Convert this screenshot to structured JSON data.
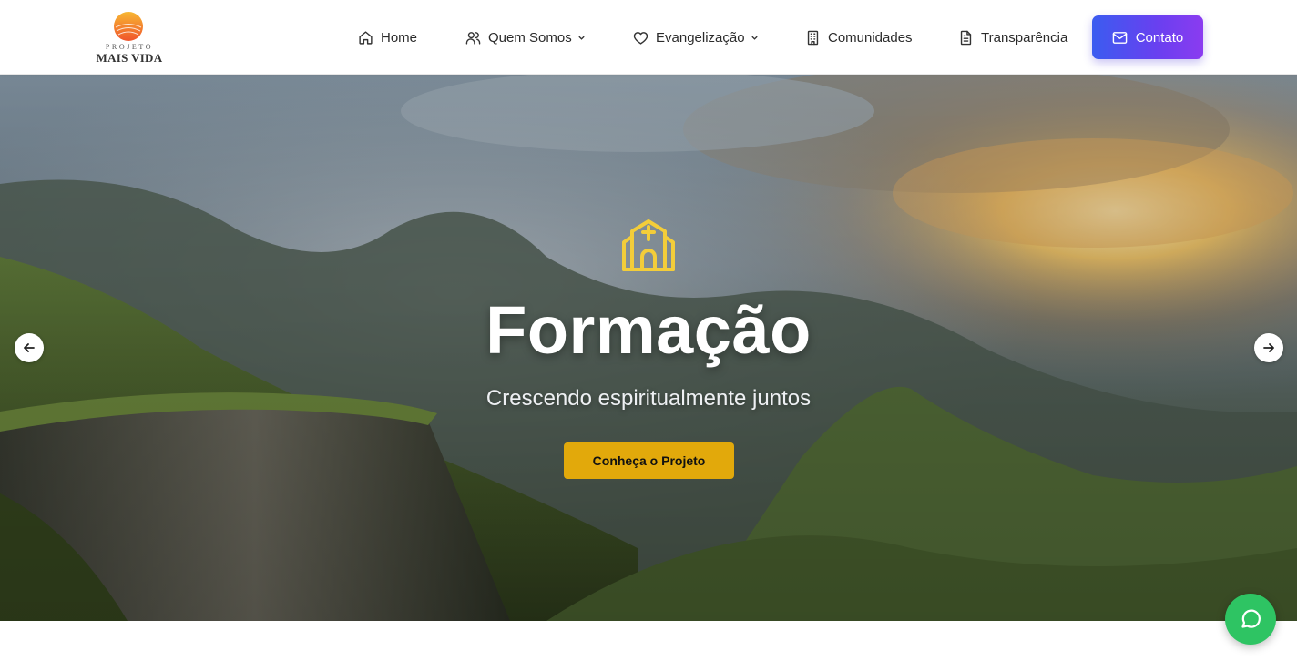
{
  "brand": {
    "top_text": "PROJETO",
    "name": "MAIS VIDA"
  },
  "nav": {
    "items": [
      {
        "label": "Home",
        "icon": "home-icon"
      },
      {
        "label": "Quem Somos",
        "icon": "users-icon",
        "has_dropdown": true
      },
      {
        "label": "Evangelização",
        "icon": "heart-icon",
        "has_dropdown": true
      },
      {
        "label": "Comunidades",
        "icon": "building-icon"
      },
      {
        "label": "Transparência",
        "icon": "document-icon"
      }
    ],
    "contact_label": "Contato",
    "contact_icon": "mail-icon"
  },
  "hero": {
    "icon": "church-icon",
    "title": "Formação",
    "subtitle": "Crescendo espiritualmente juntos",
    "cta_label": "Conheça o Projeto"
  },
  "colors": {
    "accent_gradient_start": "#3b5cf0",
    "accent_gradient_end": "#8b3cf0",
    "cta": "#e2a90b",
    "hero_icon": "#f3cd3a",
    "whatsapp": "#2ec463"
  }
}
